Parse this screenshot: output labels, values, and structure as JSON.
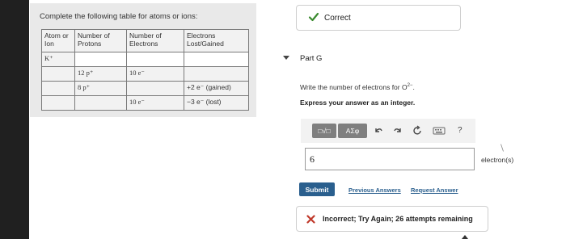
{
  "table_panel": {
    "title": "Complete the following table for atoms or ions:",
    "headers": [
      "Atom or Ion",
      "Number of Protons",
      "Number of Electrons",
      "Electrons Lost/Gained"
    ],
    "rows": [
      [
        "K⁺",
        "",
        "",
        ""
      ],
      [
        "",
        "12 p⁺",
        "10 e⁻",
        ""
      ],
      [
        "",
        "8 p⁺",
        "",
        "+2 e⁻ (gained)"
      ],
      [
        "",
        "",
        "10 e⁻",
        "−3 e⁻ (lost)"
      ]
    ]
  },
  "status_correct": {
    "text": "Correct",
    "icon": "check-icon",
    "color": "#3a8a2e"
  },
  "part": {
    "caret_icon": "triangle-down-icon",
    "title": "Part G"
  },
  "question": {
    "prompt": "Write the number of electrons for O",
    "ion_charge": "2−",
    "prompt_end": ".",
    "instruction": "Express your answer as an integer."
  },
  "toolbar": {
    "templates_label": "□√□",
    "symbols_label": "AΣφ",
    "help_label": "?",
    "icons": [
      "undo-icon",
      "redo-icon",
      "reset-icon",
      "keyboard-icon"
    ]
  },
  "answer": {
    "value": "6",
    "unit": "electron(s)"
  },
  "actions": {
    "submit": "Submit",
    "previous_answers": "Previous Answers",
    "request_answer": "Request Answer"
  },
  "status_incorrect": {
    "text": "Incorrect; Try Again; 26 attempts remaining",
    "icon": "x-icon",
    "color": "#c0392b"
  },
  "colors": {
    "sidebar": "#202020",
    "accent": "#2a5f8e",
    "panel": "#e9e9e9",
    "toolbar_button": "#7f7f7f"
  }
}
